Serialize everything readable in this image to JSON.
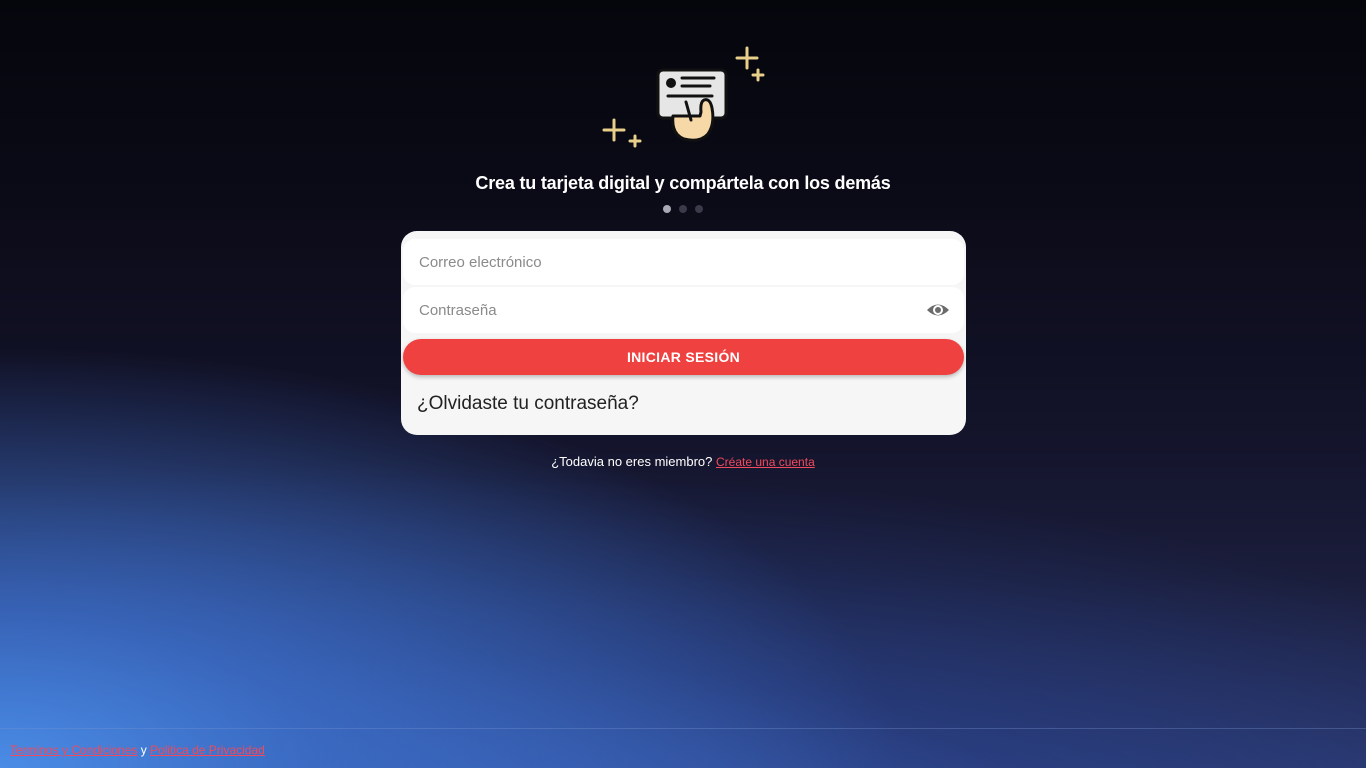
{
  "onboarding": {
    "headline": "Crea tu tarjeta digital y compártela con los demás",
    "slide_count": 3,
    "active_slide": 1,
    "illustration_icon": "hand-holding-card-icon"
  },
  "login_form": {
    "email_placeholder": "Correo electrónico",
    "email_value": "",
    "password_placeholder": "Contraseña",
    "password_value": "",
    "toggle_visibility_icon": "eye-icon",
    "submit_label": "INICIAR SESIÓN",
    "forgot_password_label": "¿Olvidaste tu contraseña?"
  },
  "signup": {
    "prompt": "¿Todavia no eres miembro?",
    "link_label": "Créate una cuenta"
  },
  "footer": {
    "terms_label": "Terminos y Condiciones",
    "conjunction": "y",
    "privacy_label": "Politica de Privacidad"
  },
  "colors": {
    "accent": "#f04141",
    "link": "#f04a5c",
    "card_background": "#f6f6f6",
    "illustration_gold": "#e8cf8a"
  }
}
